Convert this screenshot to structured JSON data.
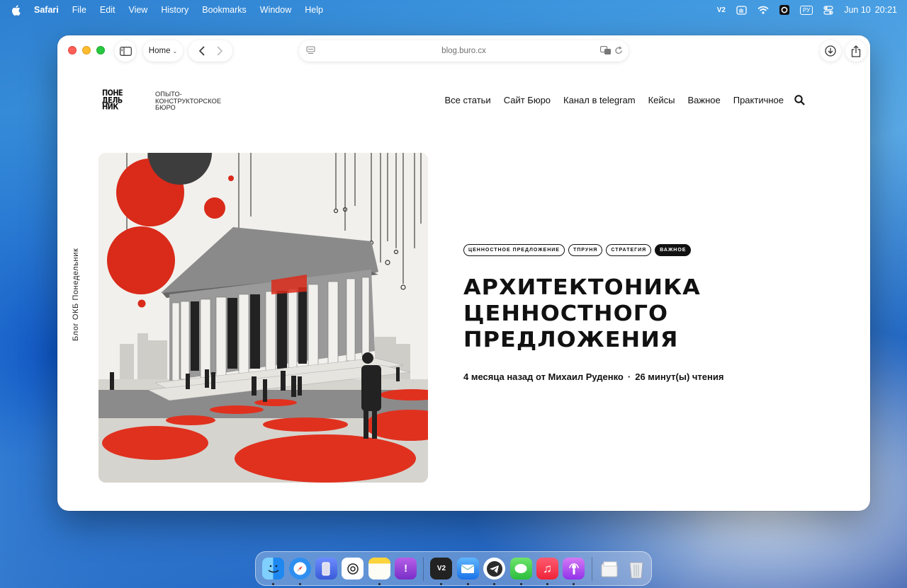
{
  "menubar": {
    "app_name": "Safari",
    "items": [
      "File",
      "Edit",
      "View",
      "History",
      "Bookmarks",
      "Window",
      "Help"
    ],
    "status_v2": "V2",
    "input_source": "РУ",
    "date": "Jun 10",
    "time": "20:21"
  },
  "safari": {
    "tab_group_label": "Home",
    "address": "blog.buro.cx"
  },
  "site": {
    "logo_lines": [
      "ПОНЕ",
      "ДЕЛЬ",
      "НИК"
    ],
    "logo_sub_lines": [
      "ОПЫТО-",
      "КОНСТРУКТОРСКОЕ",
      "БЮРО"
    ],
    "nav": [
      "Все статьи",
      "Сайт Бюро",
      "Канал в telegram",
      "Кейсы",
      "Важное",
      "Практичное"
    ],
    "vertical_label": "Блог ОКБ Понедельник"
  },
  "post": {
    "tags": [
      "ценностное предложение",
      "тпруня",
      "стратегия",
      "важное"
    ],
    "title_lines": [
      "АРХИТЕКТОНИКА",
      "ЦЕННОСТНОГО",
      "ПРЕДЛОЖЕНИЯ"
    ],
    "time_ago": "4 месяца назад от Михаил Руденко",
    "separator": "·",
    "reading_time": "26 минут(ы) чтения"
  },
  "dock": {
    "v2_label": "V2",
    "apps": [
      "finder-icon",
      "safari-icon",
      "simulator-icon",
      "chatgpt-icon",
      "notes-icon",
      "feedback-icon",
      "v2-icon",
      "mail-icon",
      "telegram-icon",
      "messages-icon",
      "music-icon",
      "podcasts-icon",
      "documents-icon",
      "trash-icon"
    ]
  },
  "colors": {
    "accent_red": "#e0311f",
    "traffic_red": "#fe5f57",
    "traffic_yellow": "#febc2e",
    "traffic_green": "#28c840"
  }
}
